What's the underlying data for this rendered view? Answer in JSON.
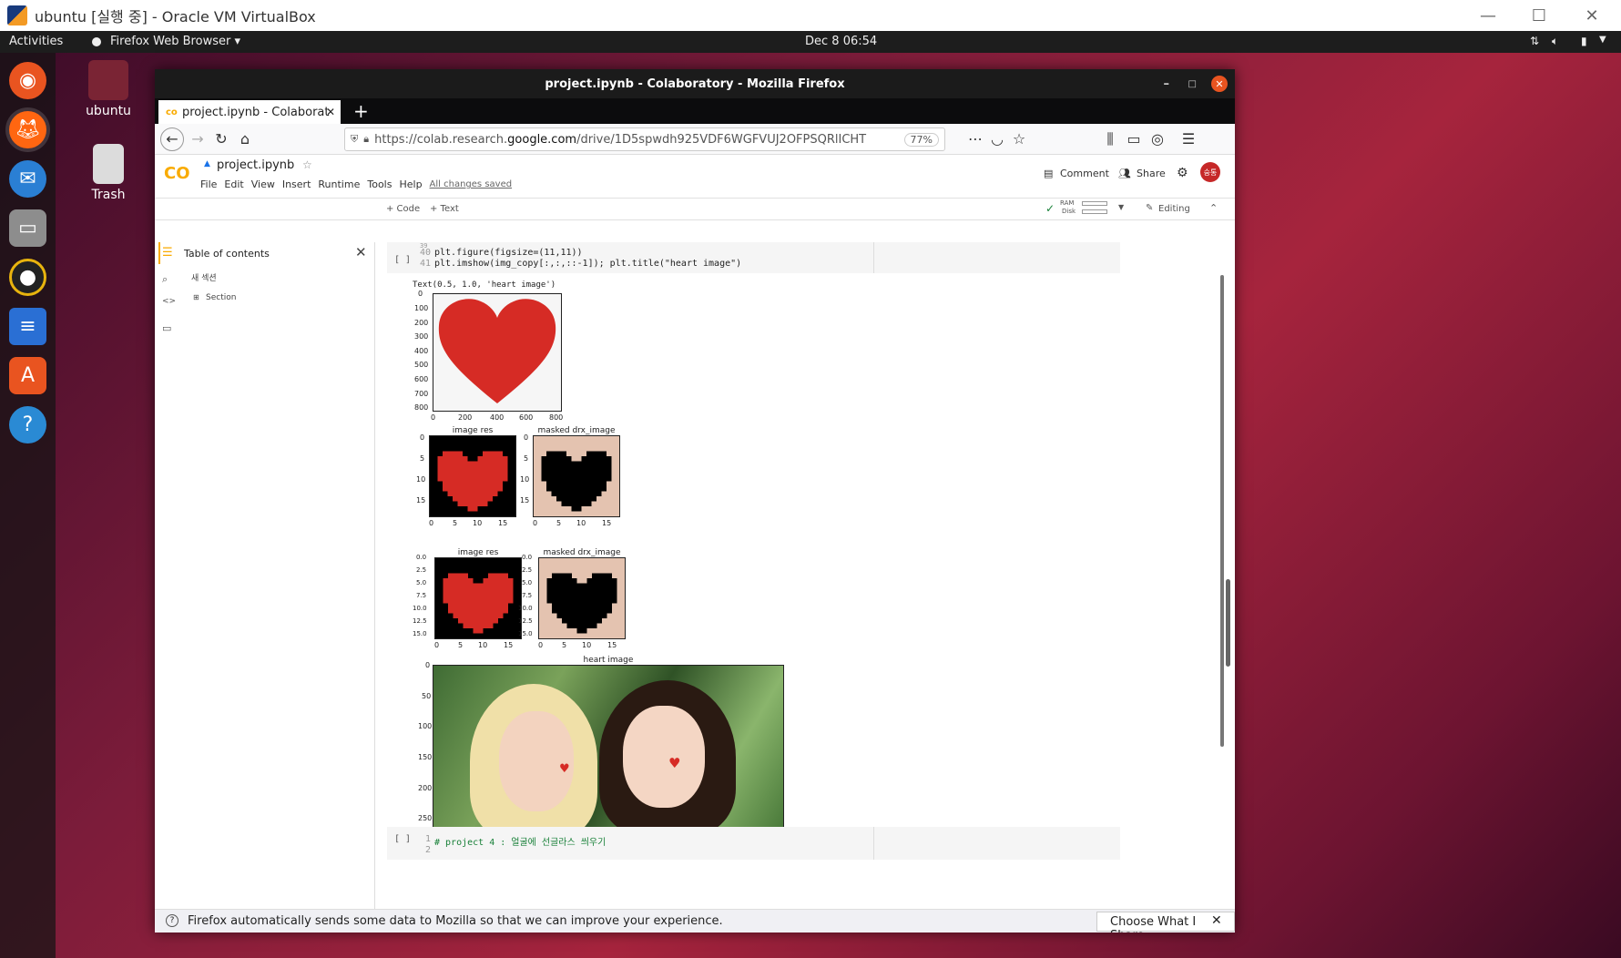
{
  "vbox": {
    "title": "ubuntu [실행 중] - Oracle VM VirtualBox",
    "min": "—",
    "max": "☐",
    "close": "✕"
  },
  "topbar": {
    "activities": "Activities",
    "app": "Firefox Web Browser ▾",
    "clock": "Dec 8  06:54"
  },
  "desktop": {
    "home_label": "ubuntu",
    "trash_label": "Trash"
  },
  "firefox": {
    "title": "project.ipynb - Colaboratory - Mozilla Firefox",
    "tab_label": "project.ipynb - Colaborat",
    "new_tab": "+",
    "url_prefix": "https://colab.research.",
    "url_domain": "google.com",
    "url_path": "/drive/1D5spwdh925VDF6WGFVUJ2OFPSQRlICHT",
    "zoom": "77%"
  },
  "colab": {
    "logo": "CO",
    "filename": "project.ipynb",
    "menu": [
      "File",
      "Edit",
      "View",
      "Insert",
      "Runtime",
      "Tools",
      "Help"
    ],
    "saved": "All changes saved",
    "comment": "Comment",
    "share": "Share",
    "avatar": "숭통",
    "add_code": "+ Code",
    "add_text": "+ Text",
    "ram": "RAM",
    "disk": "Disk",
    "editing": "Editing"
  },
  "toc": {
    "title": "Table of contents",
    "item1": "새 섹션",
    "item2": "Section"
  },
  "cell1": {
    "run": "[ ]",
    "line0": "39",
    "line1_no": "40",
    "line1": "plt.figure(figsize=(11,11))",
    "line2_no": "41",
    "line2": "plt.imshow(img_copy[:,:,::-1]); plt.title(\"heart image\")"
  },
  "output": {
    "text": "Text(0.5, 1.0, 'heart image')",
    "plot1": {
      "yticks": [
        "0",
        "100",
        "200",
        "300",
        "400",
        "500",
        "600",
        "700",
        "800"
      ],
      "xticks": [
        "0",
        "200",
        "400",
        "600",
        "800"
      ]
    },
    "plot2": {
      "title_a": "image res",
      "title_b": "masked drx_image",
      "yticks": [
        "0",
        "5",
        "10",
        "15"
      ],
      "xticks": [
        "0",
        "5",
        "10",
        "15"
      ]
    },
    "plot3": {
      "title_a": "image res",
      "title_b": "masked drx_image",
      "yticks": [
        "0.0",
        "2.5",
        "5.0",
        "7.5",
        "10.0",
        "12.5",
        "15.0"
      ],
      "xticks": [
        "0",
        "5",
        "10",
        "15"
      ]
    },
    "plot4": {
      "title": "heart image",
      "yticks": [
        "0",
        "50",
        "100",
        "150",
        "200",
        "250"
      ]
    }
  },
  "cell2": {
    "run": "[ ]",
    "line1_no": "1",
    "line1": "# project  4 : 얼굴에 선글라스 씌우기",
    "line2_no": "2"
  },
  "notification": {
    "text": "Firefox automatically sends some data to Mozilla so that we can improve your experience.",
    "button": "Choose What I Share"
  }
}
